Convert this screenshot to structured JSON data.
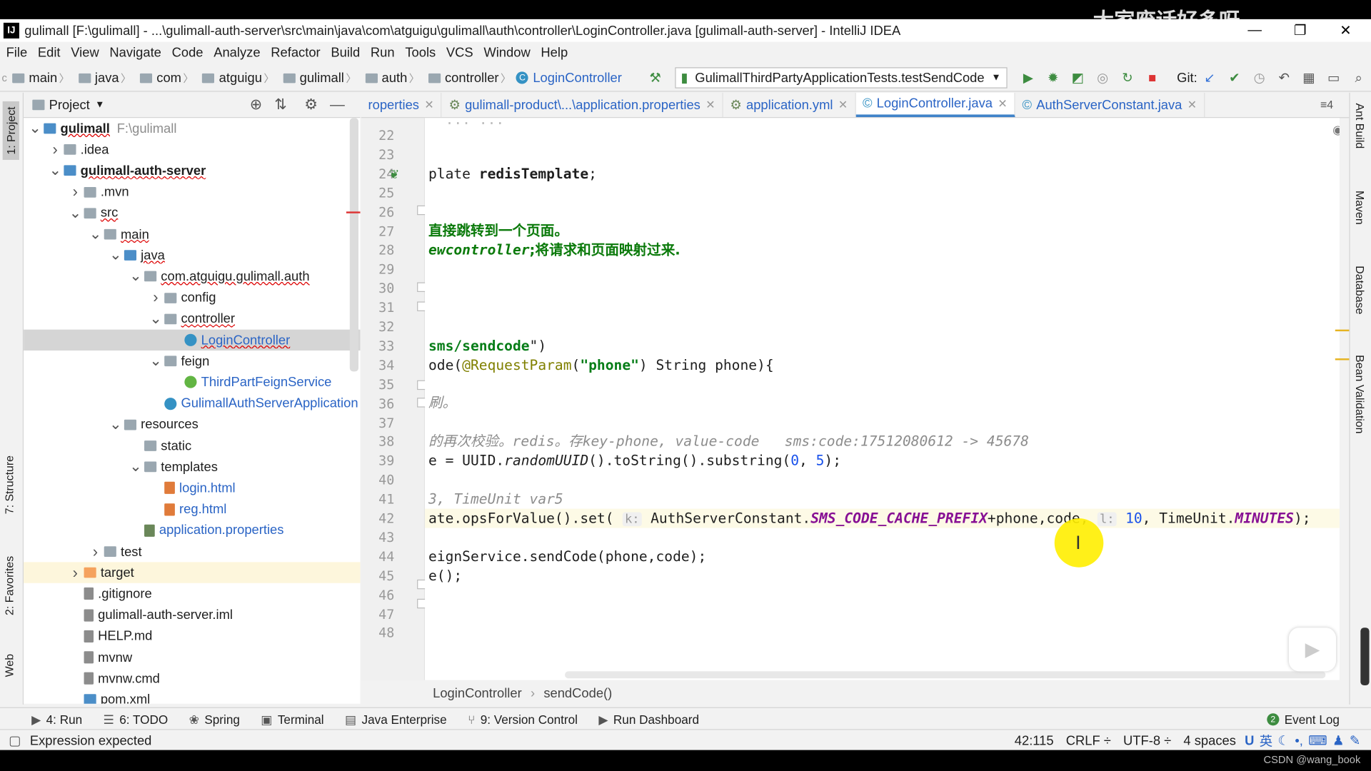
{
  "window": {
    "title": "gulimall [F:\\gulimall] - ...\\gulimall-auth-server\\src\\main\\java\\com\\atguigu\\gulimall\\auth\\controller\\LoginController.java [gulimall-auth-server] - IntelliJ IDEA",
    "watermark": "大家废话好多呀",
    "minimize": "—",
    "restore": "❐",
    "close": "✕"
  },
  "menu": [
    "File",
    "Edit",
    "View",
    "Navigate",
    "Code",
    "Analyze",
    "Refactor",
    "Build",
    "Run",
    "Tools",
    "VCS",
    "Window",
    "Help"
  ],
  "nav": {
    "crumbs": [
      "main",
      "java",
      "com",
      "atguigu",
      "gulimall",
      "auth",
      "controller"
    ],
    "current": "LoginController",
    "run_config": "GulimallThirdPartyApplicationTests.testSendCode",
    "git_label": "Git:"
  },
  "project_panel": {
    "title": "Project",
    "tree": [
      {
        "label": "gulimall",
        "extra": "F:\\gulimall",
        "depth": 0,
        "arrow": "down",
        "icon": "m",
        "bold": true
      },
      {
        "label": ".idea",
        "depth": 1,
        "arrow": "right",
        "icon": "f"
      },
      {
        "label": "gulimall-auth-server",
        "depth": 1,
        "arrow": "down",
        "icon": "m",
        "bold": true
      },
      {
        "label": ".mvn",
        "depth": 2,
        "arrow": "right",
        "icon": "f"
      },
      {
        "label": "src",
        "depth": 2,
        "arrow": "down",
        "icon": "f"
      },
      {
        "label": "main",
        "depth": 3,
        "arrow": "down",
        "icon": "f"
      },
      {
        "label": "java",
        "depth": 4,
        "arrow": "down",
        "icon": "m"
      },
      {
        "label": "com.atguigu.gulimall.auth",
        "depth": 5,
        "arrow": "down",
        "icon": "f"
      },
      {
        "label": "config",
        "depth": 6,
        "arrow": "right",
        "icon": "f"
      },
      {
        "label": "controller",
        "depth": 6,
        "arrow": "down",
        "icon": "f"
      },
      {
        "label": "LoginController",
        "depth": 7,
        "arrow": "",
        "icon": "c",
        "selected": true
      },
      {
        "label": "feign",
        "depth": 6,
        "arrow": "down",
        "icon": "f"
      },
      {
        "label": "ThirdPartFeignService",
        "depth": 7,
        "arrow": "",
        "icon": "i"
      },
      {
        "label": "GulimallAuthServerApplication",
        "depth": 6,
        "arrow": "",
        "icon": "c"
      },
      {
        "label": "resources",
        "depth": 4,
        "arrow": "down",
        "icon": "f"
      },
      {
        "label": "static",
        "depth": 5,
        "arrow": "",
        "icon": "f"
      },
      {
        "label": "templates",
        "depth": 5,
        "arrow": "down",
        "icon": "f"
      },
      {
        "label": "login.html",
        "depth": 6,
        "arrow": "",
        "icon": "h"
      },
      {
        "label": "reg.html",
        "depth": 6,
        "arrow": "",
        "icon": "h"
      },
      {
        "label": "application.properties",
        "depth": 5,
        "arrow": "",
        "icon": "g"
      },
      {
        "label": "test",
        "depth": 3,
        "arrow": "right",
        "icon": "f"
      },
      {
        "label": "target",
        "depth": 2,
        "arrow": "right",
        "icon": "o",
        "highlight": true
      },
      {
        "label": ".gitignore",
        "depth": 2,
        "arrow": "",
        "icon": "t"
      },
      {
        "label": "gulimall-auth-server.iml",
        "depth": 2,
        "arrow": "",
        "icon": "t"
      },
      {
        "label": "HELP.md",
        "depth": 2,
        "arrow": "",
        "icon": "t"
      },
      {
        "label": "mvnw",
        "depth": 2,
        "arrow": "",
        "icon": "t"
      },
      {
        "label": "mvnw.cmd",
        "depth": 2,
        "arrow": "",
        "icon": "t"
      },
      {
        "label": "pom.xml",
        "depth": 2,
        "arrow": "",
        "icon": "m"
      }
    ]
  },
  "tabs": [
    {
      "label": "roperties",
      "active": false
    },
    {
      "label": "gulimall-product\\...\\application.properties",
      "active": false
    },
    {
      "label": "application.yml",
      "active": false
    },
    {
      "label": "LoginController.java",
      "active": true
    },
    {
      "label": "AuthServerConstant.java",
      "active": false
    }
  ],
  "tabs_extra": "≡4",
  "line_numbers": [
    "22",
    "23",
    "24",
    "25",
    "26",
    "27",
    "28",
    "29",
    "30",
    "31",
    "32",
    "33",
    "34",
    "35",
    "36",
    "37",
    "38",
    "39",
    "40",
    "41",
    "42",
    "43",
    "44",
    "45",
    "46",
    "47",
    "48"
  ],
  "code": {
    "l24a": "plate ",
    "l24b": "redisTemplate",
    "l24c": ";",
    "l27": "直接跳转到一个页面。",
    "l28a": "ewcontroller",
    "l28b": ";将请求和页面映射过来.",
    "l33a": "sms/sendcode",
    "l33b": "\")",
    "l34a": "ode(",
    "l34b": "@RequestParam",
    "l34c": "(",
    "l34d": "\"phone\"",
    "l34e": ") String phone){",
    "l36": "刷。",
    "l38": "的再次校验。redis。存key-phone, value-code   sms:code:17512080612 -> 45678",
    "l39a": "e = UUID.",
    "l39b": "randomUUID",
    "l39c": "().toString().substring(",
    "l39d": "0",
    "l39e": ", ",
    "l39f": "5",
    "l39g": ");",
    "l41": "3, TimeUnit var5",
    "l42a": "ate.opsForValue().set( ",
    "l42h1": "k:",
    "l42b": " AuthServerConstant.",
    "l42c": "SMS_CODE_CACHE_PREFIX",
    "l42d": "+phone,code, ",
    "l42h2": "l:",
    "l42e": " ",
    "l42f": "10",
    "l42g": ", TimeUnit.",
    "l42i": "MINUTES",
    "l42j": ");",
    "l44": "eignService.sendCode(phone,code);",
    "l45": "e();"
  },
  "editor_breadcrumb": [
    "LoginController",
    "sendCode()"
  ],
  "left_tabs": [
    "1: Project",
    "7: Structure",
    "2: Favorites",
    "Web"
  ],
  "right_tabs": [
    "Ant Build",
    "Maven",
    "Database",
    "Bean Validation"
  ],
  "tool_windows": [
    {
      "icon": "▶",
      "label": "4: Run"
    },
    {
      "icon": "☰",
      "label": "6: TODO"
    },
    {
      "icon": "❀",
      "label": "Spring"
    },
    {
      "icon": "▣",
      "label": "Terminal"
    },
    {
      "icon": "▤",
      "label": "Java Enterprise"
    },
    {
      "icon": "⑂",
      "label": "9: Version Control"
    },
    {
      "icon": "▶",
      "label": "Run Dashboard"
    }
  ],
  "event_log": "Event Log",
  "status": {
    "message": "Expression expected",
    "position": "42:115",
    "line_sep": "CRLF ÷",
    "encoding": "UTF-8 ÷",
    "indent": "4 spaces",
    "ime": "英"
  },
  "credit": "CSDN @wang_book"
}
